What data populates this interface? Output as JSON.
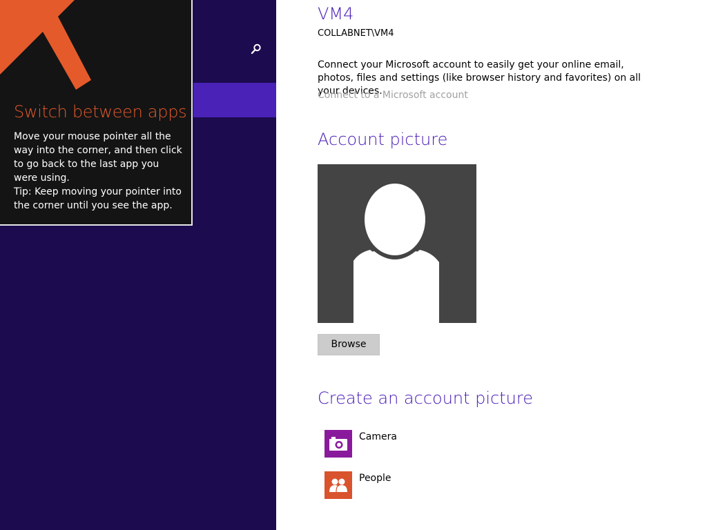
{
  "colors": {
    "left_bg": "#1c0b4f",
    "selected_bar": "#4a22b8",
    "accent_heading": "#4617b4",
    "tip_bg": "#141414",
    "tip_title": "#e55a2b",
    "camera_tile": "#8a1a9c",
    "people_tile": "#d9532c"
  },
  "search": {
    "icon": "search-icon"
  },
  "tip": {
    "arrow_icon": "arrow-up-left-icon",
    "title": "Switch between apps",
    "body_line1": "Move your mouse pointer all the way into the corner, and then click to go back to the last app you were using.",
    "body_line2": "Tip: Keep moving your pointer into the corner until you see the app."
  },
  "account": {
    "name": "VM4",
    "domain": "COLLABNET\\VM4",
    "description": "Connect your Microsoft account to easily get your online email, photos, files and settings (like browser history and favorites) on all your devices.",
    "connect_link": "Connect to a Microsoft account"
  },
  "picture": {
    "heading": "Account picture",
    "browse_label": "Browse"
  },
  "create": {
    "heading": "Create an account picture",
    "apps": [
      {
        "label": "Camera",
        "icon": "camera-icon"
      },
      {
        "label": "People",
        "icon": "people-icon"
      }
    ]
  }
}
